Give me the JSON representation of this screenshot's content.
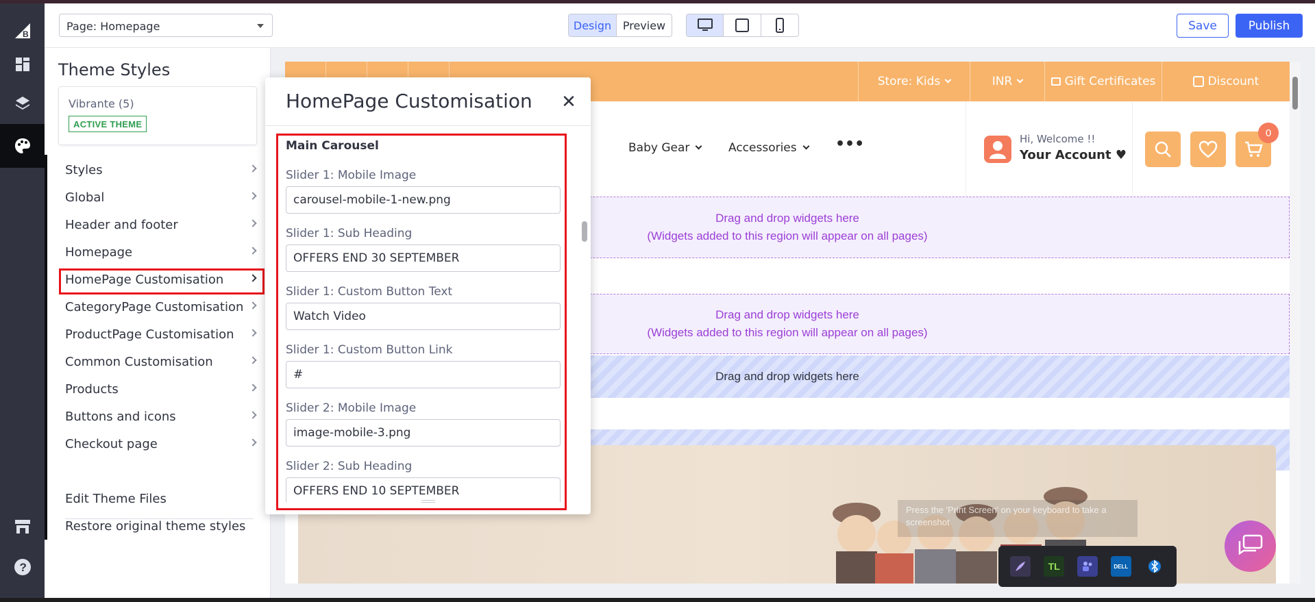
{
  "topbar": {
    "page_select": "Page: Homepage",
    "view_modes": [
      "Design",
      "Preview"
    ],
    "active_view_mode": "Design",
    "devices": [
      "desktop-icon",
      "tablet-icon",
      "mobile-icon"
    ],
    "active_device": "desktop-icon",
    "save_label": "Save",
    "publish_label": "Publish"
  },
  "theme_panel": {
    "title": "Theme Styles",
    "theme_name": "Vibrante (5)",
    "theme_badge": "ACTIVE THEME",
    "menu": [
      "Styles",
      "Global",
      "Header and footer",
      "Homepage",
      "HomePage Customisation",
      "CategoryPage Customisation",
      "ProductPage Customisation",
      "Common Customisation",
      "Products",
      "Buttons and icons",
      "Checkout page"
    ],
    "selected_item": "HomePage Customisation",
    "footer_links": [
      "Edit Theme Files",
      "Restore original theme styles"
    ]
  },
  "modal": {
    "title": "HomePage Customisation",
    "section": "Main Carousel",
    "fields": [
      {
        "label": "Slider 1: Mobile Image",
        "value": "carousel-mobile-1-new.png"
      },
      {
        "label": "Slider 1: Sub Heading",
        "value": "OFFERS END 30 SEPTEMBER"
      },
      {
        "label": "Slider 1: Custom Button Text",
        "value": "Watch Video"
      },
      {
        "label": "Slider 1: Custom Button Link",
        "value": "#"
      },
      {
        "label": "Slider 2: Mobile Image",
        "value": "image-mobile-3.png"
      },
      {
        "label": "Slider 2: Sub Heading",
        "value": "OFFERS END 10 SEPTEMBER"
      }
    ]
  },
  "storefront": {
    "top_bar": [
      "Store: Kids",
      "INR",
      "Gift Certificates",
      "Discount"
    ],
    "nav": [
      "Baby Gear",
      "Accessories"
    ],
    "account_greeting": "Hi, Welcome !!",
    "account_label": "Your Account",
    "cart_count": "0",
    "drop_zone_title": "Drag and drop widgets here",
    "drop_zone_note": "(Widgets added to this region will appear on all pages)",
    "screenshot_hint": "Press the 'Print Screen' on your keyboard to take a screenshot"
  },
  "colors": {
    "accent": "#3c64f4",
    "storefront_orange": "#f8b46b",
    "highlight_red": "#e8141b",
    "active_badge_green": "#2e9e4f",
    "drop_zone_purple": "#9b3fd6"
  }
}
